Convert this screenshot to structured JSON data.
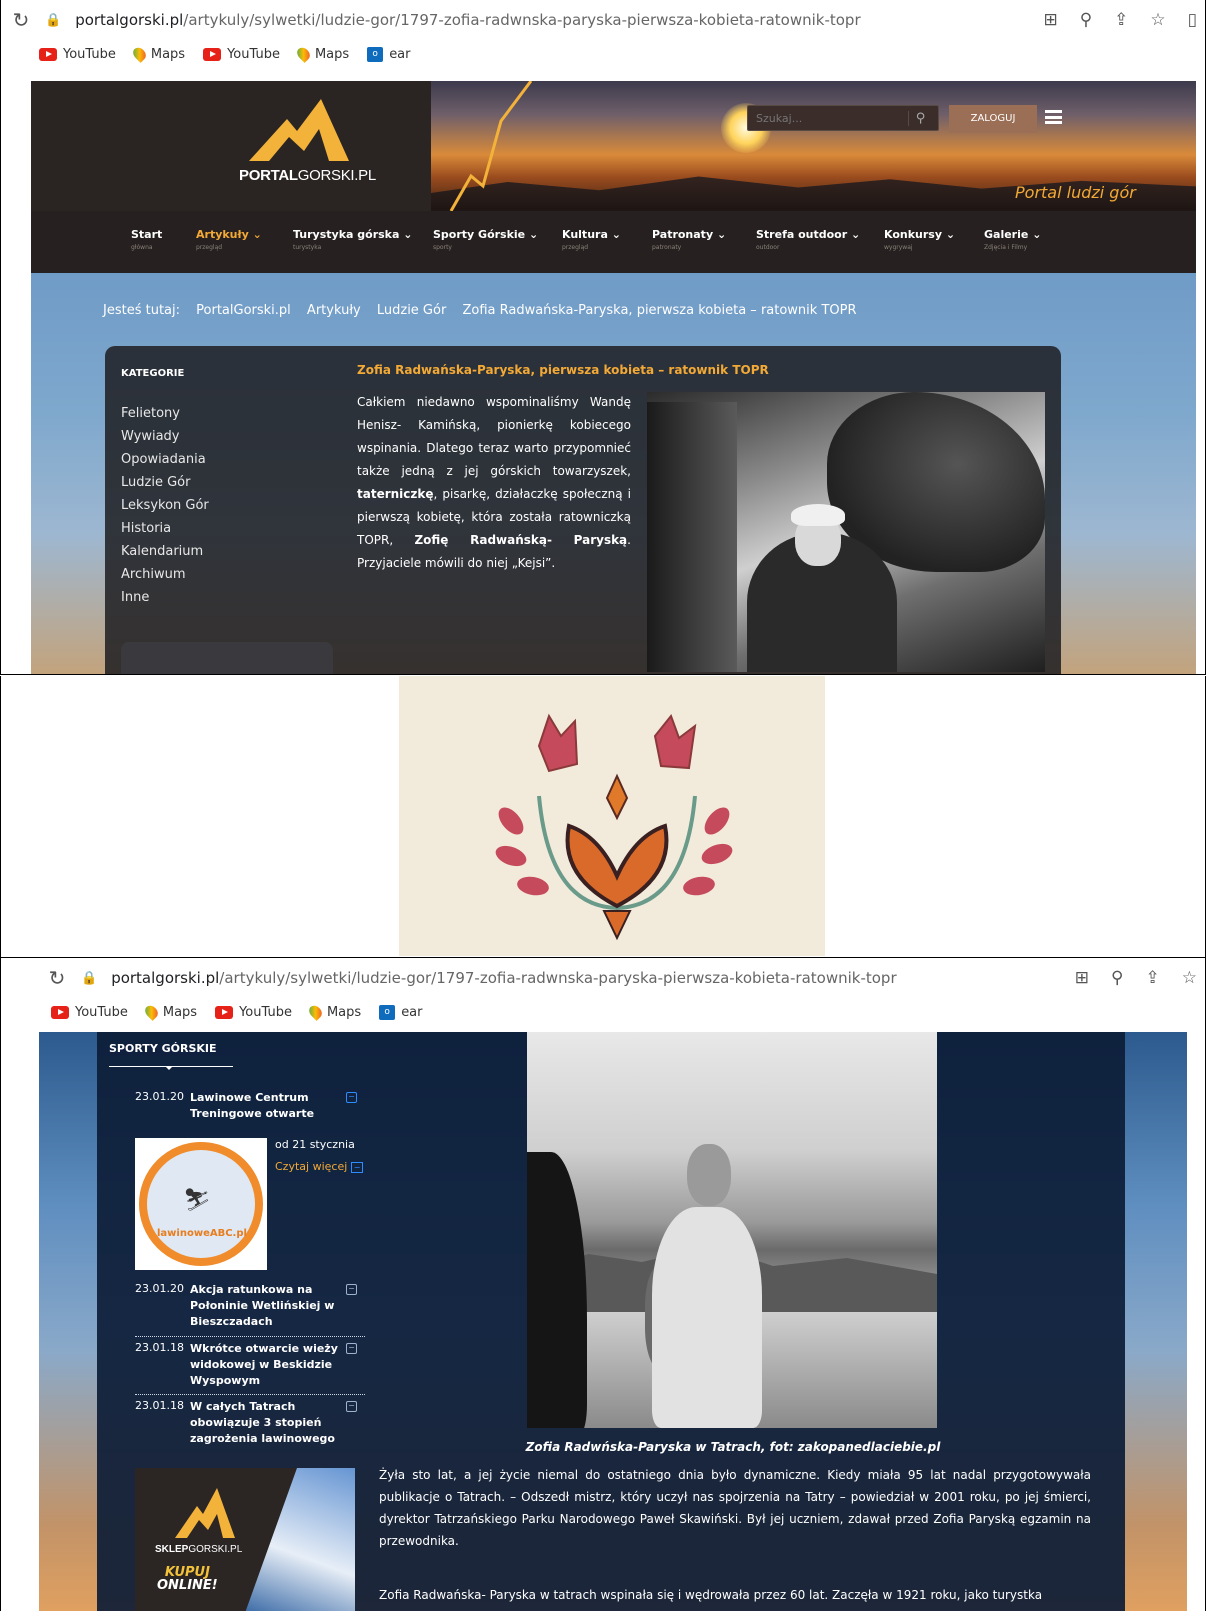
{
  "browser": {
    "url_host": "portalgorski.pl",
    "url_path": "/artykuly/sylwetki/ludzie-gor/1797-zofia-radwnska-paryska-pierwsza-kobieta-ratownik-topr",
    "bookmarks": [
      "YouTube",
      "Maps",
      "YouTube",
      "Maps",
      "ear"
    ]
  },
  "site": {
    "logo_text_bold": "PORTAL",
    "logo_text_light": "GORSKI.PL",
    "search_placeholder": "Szukaj...",
    "login_label": "ZALOGUJ",
    "tagline": "Portal ludzi gór",
    "menu": [
      {
        "label": "Start",
        "sub": "główna",
        "arrow": ""
      },
      {
        "label": "Artykuły",
        "sub": "przegląd",
        "arrow": "⌄"
      },
      {
        "label": "Turystyka górska",
        "sub": "turystyka",
        "arrow": "⌄"
      },
      {
        "label": "Sporty Górskie",
        "sub": "sporty",
        "arrow": "⌄"
      },
      {
        "label": "Kultura",
        "sub": "przegląd",
        "arrow": "⌄"
      },
      {
        "label": "Patronaty",
        "sub": "patronaty",
        "arrow": "⌄"
      },
      {
        "label": "Strefa outdoor",
        "sub": "outdoor",
        "arrow": "⌄"
      },
      {
        "label": "Konkursy",
        "sub": "wygrywaj",
        "arrow": "⌄"
      },
      {
        "label": "Galerie",
        "sub": "Zdjęcia i Filmy",
        "arrow": "⌄"
      }
    ],
    "active_menu": "Artykuły"
  },
  "breadcrumb": {
    "lead": "Jesteś tutaj:",
    "items": [
      "PortalGorski.pl",
      "Artykuły",
      "Ludzie Gór",
      "Zofia Radwańska-Paryska, pierwsza kobieta – ratownik TOPR"
    ]
  },
  "sidebar": {
    "title": "KATEGORIE",
    "items": [
      "Felietony",
      "Wywiady",
      "Opowiadania",
      "Ludzie Gór",
      "Leksykon Gór",
      "Historia",
      "Kalendarium",
      "Archiwum",
      "Inne"
    ]
  },
  "article": {
    "title": "Zofia Radwańska-Paryska, pierwsza kobieta – ratownik TOPR",
    "intro_1": "Całkiem niedawno wspominaliśmy Wandę Henisz- Kamińską, pionierkę kobiecego wspinania. Dlatego teraz warto przypomnieć także jedną z jej górskich towarzyszek, ",
    "intro_bold_1": "taterniczkę",
    "intro_2": ", pisarkę, działaczkę społeczną i pierwszą kobietę, która została ratowniczką TOPR, ",
    "intro_bold_2": "Zofię Radwańską- Paryską",
    "intro_3": ". Przyjaciele mówili do niej „Kejsi”.",
    "caption": "Zofia Radwńska-Paryska w Tatrach, fot: zakopanedlaciebie.pl",
    "para1": "Żyła sto lat, a jej życie niemal do ostatniego dnia było dynamiczne. Kiedy miała 95 lat nadal przygotowywała publikacje o Tatrach. – Odszedł mistrz, który uczył nas spojrzenia na Tatry – powiedział w 2001 roku, po jej śmierci, dyrektor Tatrzańskiego Parku Narodowego Paweł Skawiński. Był jej uczniem, zdawał przed Zofia Paryską egzamin na przewodnika.",
    "para2": "Zofia Radwańska- Paryska w tatrach wspinała się i wędrowała przez 60 lat. Zaczęła w 1921 roku, jako turystka"
  },
  "sporty": {
    "title": "SPORTY GÓRSKIE",
    "news": [
      {
        "date": "23.01.20",
        "title": "Lawinowe Centrum Treningowe otwarte"
      },
      {
        "date": "23.01.20",
        "title": "Akcja ratunkowa na Połoninie Wetlińskiej w Bieszczadach"
      },
      {
        "date": "23.01.18",
        "title": "Wkrótce otwarcie wieży widokowej w Beskidzie Wyspowym"
      },
      {
        "date": "23.01.18",
        "title": "W całych Tatrach obowiązuje 3 stopień zagrożenia lawinowego"
      }
    ],
    "thumb_label": "lawinoweABC.pl",
    "thumb_date": "od 21 stycznia",
    "read_more": "Czytaj więcej",
    "toggle_open": "−",
    "shop_bold": "SKLEP",
    "shop_light": "GORSKI.PL",
    "shop_cta_1": "KUPUJ",
    "shop_cta_2": "ONLINE!"
  },
  "colors": {
    "accent": "#f3a936",
    "header_bg": "#2a2522"
  },
  "icons": [
    "reload-icon",
    "lock-icon",
    "translate-icon",
    "zoom-icon",
    "share-icon",
    "star-icon",
    "sidepanel-icon",
    "search-icon",
    "menu-icon",
    "mountain-logo-icon",
    "folk-ornament-icon"
  ]
}
